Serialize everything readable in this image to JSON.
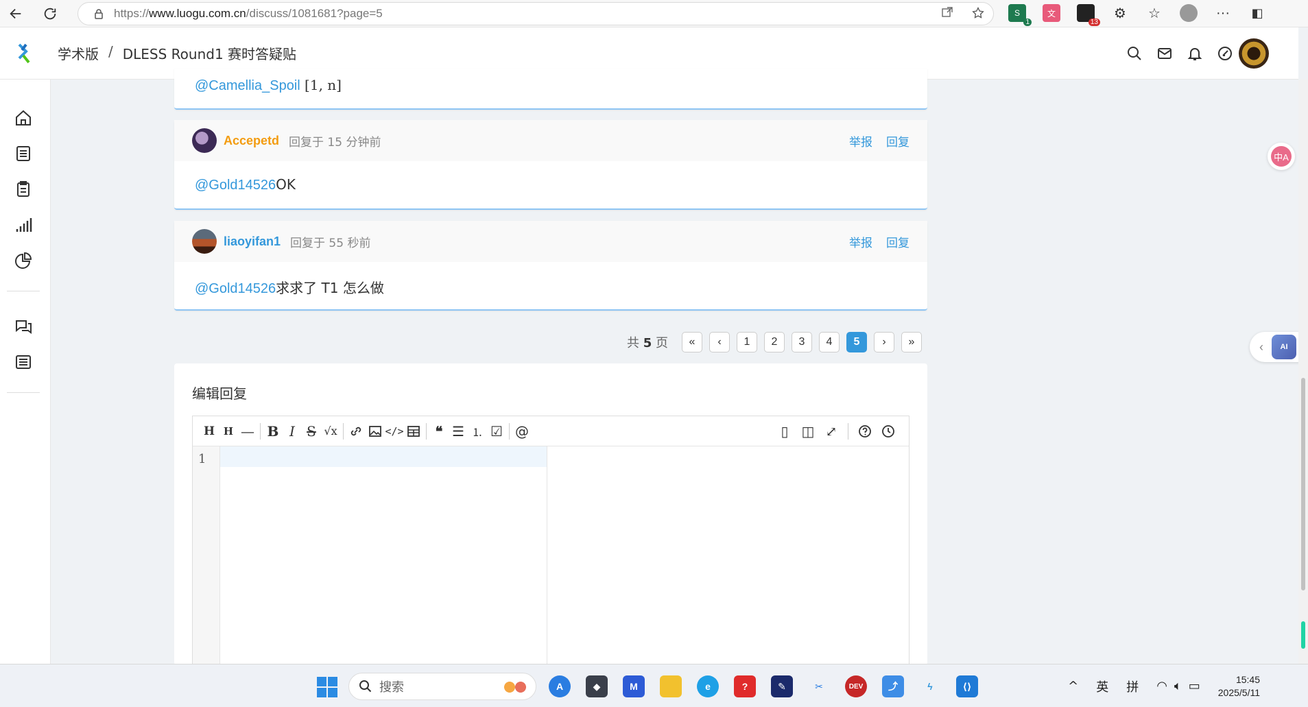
{
  "browser": {
    "url_prefix": "https://",
    "url_host": "www.luogu.com.cn",
    "url_path": "/discuss/1081681?page=5",
    "ext_badges": [
      "1",
      "13"
    ]
  },
  "header": {
    "crumb_section": "学术版",
    "crumb_sep": "/",
    "crumb_title": "DLESS Round1 赛时答疑贴"
  },
  "posts": [
    {
      "body_mention": "@Camellia_Spoil",
      "body_text": " [1, n]"
    },
    {
      "user": "Accepetd",
      "user_color": "#f39c11",
      "time": "回复于 15 分钟前",
      "report": "举报",
      "reply": "回复",
      "body_mention": "@Gold14526",
      "body_text": "OK"
    },
    {
      "user": "liaoyifan1",
      "user_color": "#3498db",
      "time": "回复于 55 秒前",
      "report": "举报",
      "reply": "回复",
      "body_mention": "@Gold14526",
      "body_text": "求求了 T1 怎么做"
    }
  ],
  "pager": {
    "total_prefix": "共",
    "total_pages": "5",
    "total_suffix": "页",
    "pages": [
      "1",
      "2",
      "3",
      "4",
      "5"
    ],
    "current": "5"
  },
  "editor": {
    "title": "编辑回复",
    "line_number": "1"
  },
  "floating": {
    "translate_label": "中A",
    "ai_label": "AI"
  },
  "taskbar": {
    "search_placeholder": "搜索",
    "ime_lang": "英",
    "ime_mode": "拼",
    "time": "15:45",
    "date": "2025/5/11"
  }
}
